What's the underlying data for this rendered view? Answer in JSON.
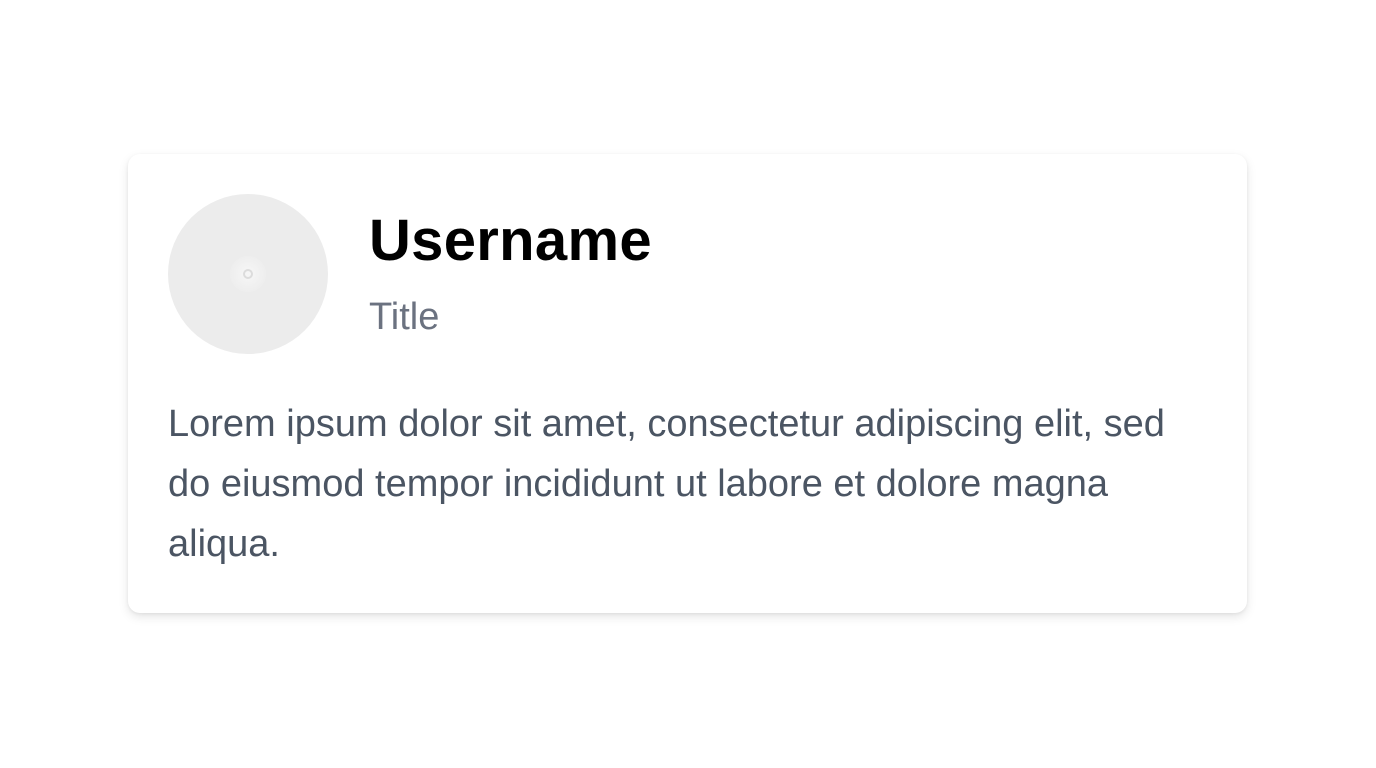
{
  "profile": {
    "username": "Username",
    "title": "Title",
    "bio": "Lorem ipsum dolor sit amet, consectetur adipiscing elit, sed do eiusmod tempor incididunt ut labore et dolore magna aliqua.",
    "avatar_icon": "image-placeholder-icon"
  },
  "colors": {
    "page_background": "#ffffff",
    "card_background": "#ffffff",
    "avatar_background": "#ececec",
    "username": "#000000",
    "title": "#6b7280",
    "bio": "#4b5563"
  }
}
